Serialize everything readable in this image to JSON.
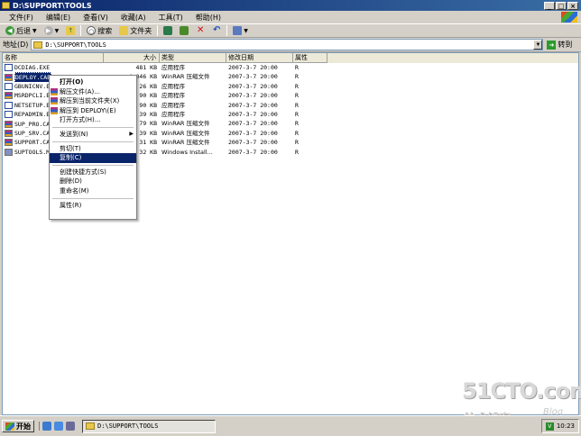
{
  "window": {
    "title": "D:\\SUPPORT\\TOOLS"
  },
  "menubar": {
    "items": [
      "文件(F)",
      "编辑(E)",
      "查看(V)",
      "收藏(A)",
      "工具(T)",
      "帮助(H)"
    ]
  },
  "toolbar": {
    "back": "后退",
    "search": "搜索",
    "folders": "文件夹"
  },
  "address": {
    "label": "地址(D)",
    "value": "D:\\SUPPORT\\TOOLS",
    "go": "转到"
  },
  "columns": {
    "name": "名称",
    "size": "大小",
    "type": "类型",
    "modified": "修改日期",
    "attributes": "属性"
  },
  "files": [
    {
      "name": "DCDIAG.EXE",
      "size": "481 KB",
      "type": "应用程序",
      "modified": "2007-3-7 20:00",
      "attr": "R",
      "icon": "exe-icon"
    },
    {
      "name": "DEPLOY.CAB",
      "size": "4,046 KB",
      "type": "WinRAR 压缩文件",
      "modified": "2007-3-7 20:00",
      "attr": "R",
      "icon": "cab-icon"
    },
    {
      "name": "GBUNICNV.E",
      "size": "26 KB",
      "type": "应用程序",
      "modified": "2007-3-7 20:00",
      "attr": "R",
      "icon": "exe-icon"
    },
    {
      "name": "MSRDPCLI.E",
      "size": "90 KB",
      "type": "应用程序",
      "modified": "2007-3-7 20:00",
      "attr": "R",
      "icon": "cab-icon"
    },
    {
      "name": "NETSETUP.E",
      "size": "90 KB",
      "type": "应用程序",
      "modified": "2007-3-7 20:00",
      "attr": "R",
      "icon": "exe-icon"
    },
    {
      "name": "REPADMIN.E",
      "size": "39 KB",
      "type": "应用程序",
      "modified": "2007-3-7 20:00",
      "attr": "R",
      "icon": "exe-icon"
    },
    {
      "name": "SUP_PRO.CA",
      "size": "79 KB",
      "type": "WinRAR 压缩文件",
      "modified": "2007-3-7 20:00",
      "attr": "R",
      "icon": "cab-icon"
    },
    {
      "name": "SUP_SRV.CA",
      "size": "39 KB",
      "type": "WinRAR 压缩文件",
      "modified": "2007-3-7 20:00",
      "attr": "R",
      "icon": "cab-icon"
    },
    {
      "name": "SUPPORT.CA",
      "size": "31 KB",
      "type": "WinRAR 压缩文件",
      "modified": "2007-3-7 20:00",
      "attr": "R",
      "icon": "cab-icon"
    },
    {
      "name": "SUPTOOLS.M",
      "size": "32 KB",
      "type": "Windows Install...",
      "modified": "2007-3-7 20:00",
      "attr": "R",
      "icon": "msi-icon"
    }
  ],
  "context_menu": {
    "open": "打开(O)",
    "extract_files": "解压文件(A)...",
    "extract_here": "解压到当前文件夹(X)",
    "extract_to": "解压到 DEPLOY\\(E)",
    "open_with": "打开方式(H)...",
    "send_to": "发送到(N)",
    "cut": "剪切(T)",
    "copy": "复制(C)",
    "create_shortcut": "创建快捷方式(S)",
    "delete": "删除(D)",
    "rename": "重命名(M)",
    "properties": "属性(R)"
  },
  "watermark": {
    "main": "51CTO.com",
    "sub": "技术博客",
    "blog": "Blog"
  },
  "taskbar": {
    "start": "开始",
    "task": "D:\\SUPPORT\\TOOLS",
    "clock": "10:23"
  }
}
